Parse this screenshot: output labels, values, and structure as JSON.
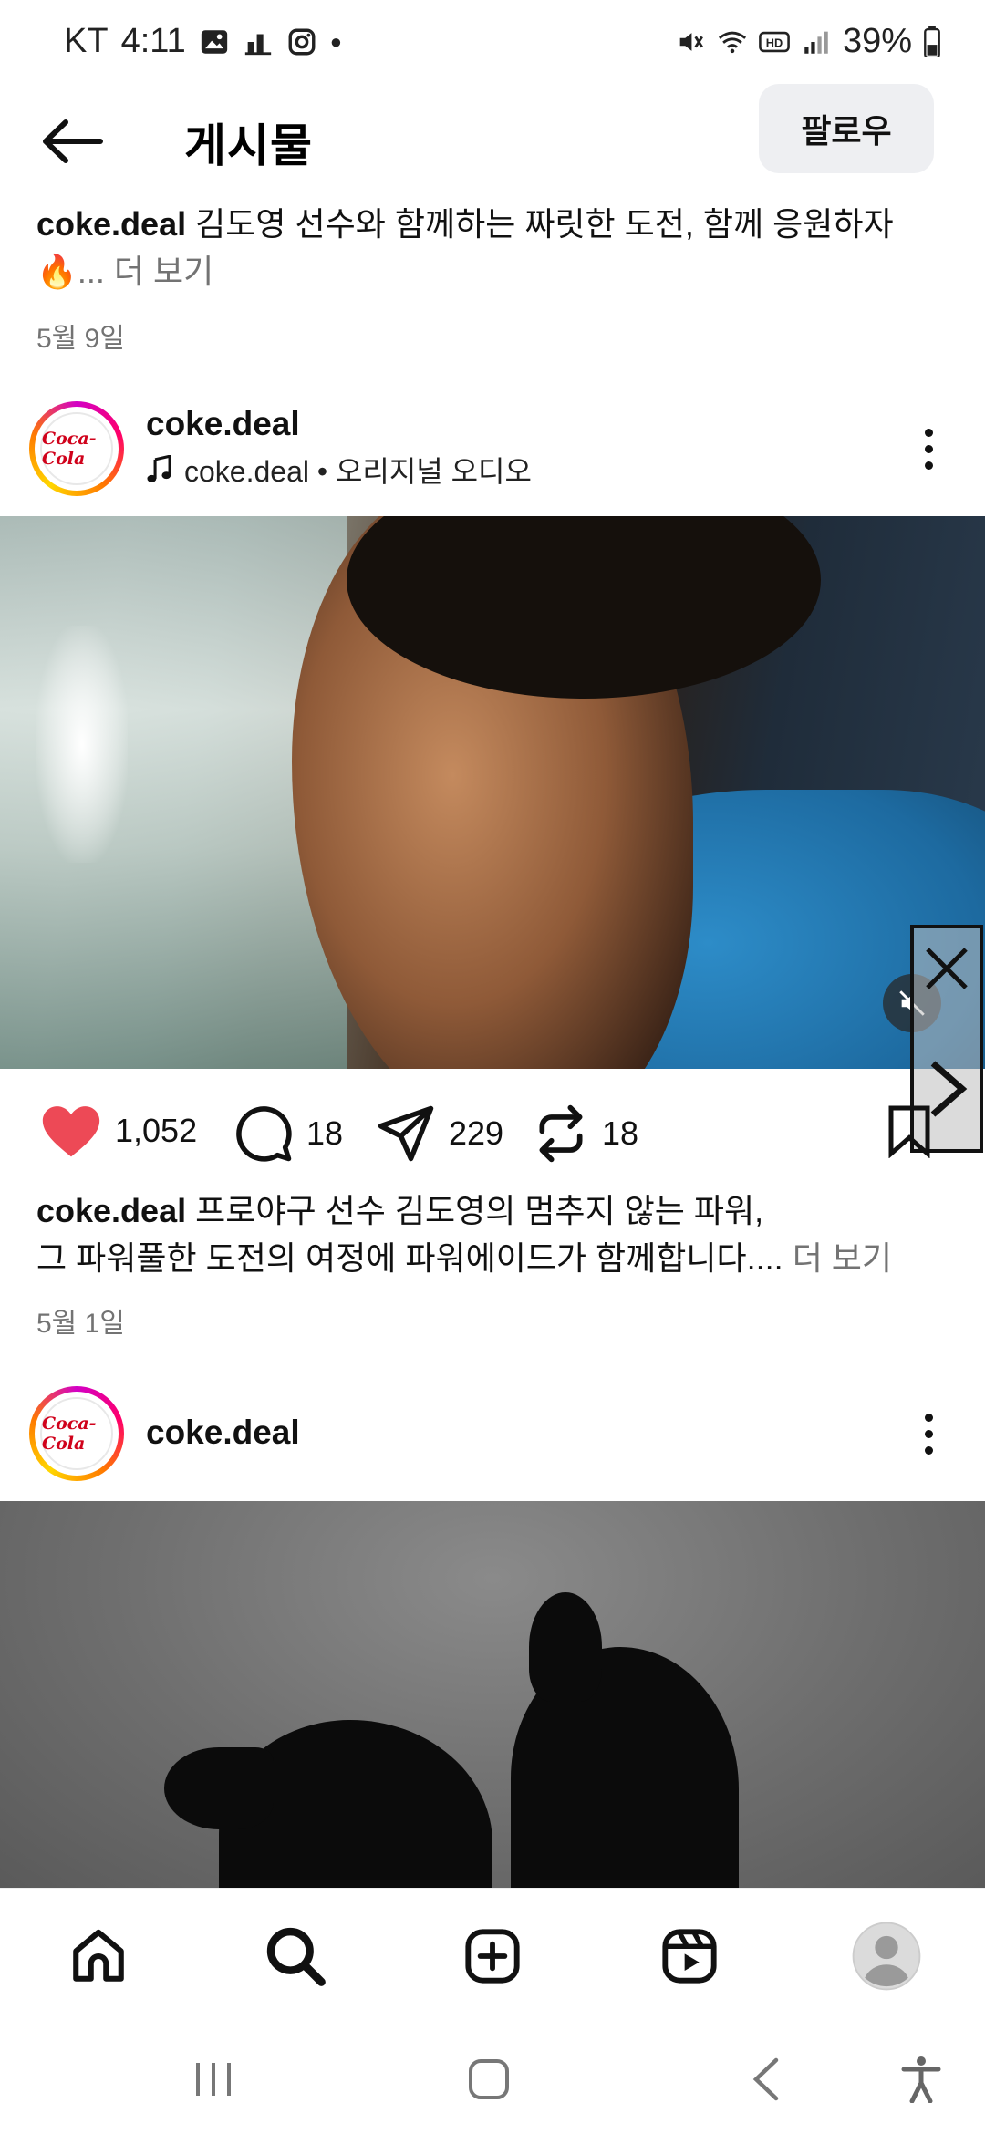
{
  "status_bar": {
    "carrier": "KT",
    "time": "4:11",
    "battery": "39%",
    "left_icons": [
      "gallery-icon",
      "chart-icon",
      "instagram-icon",
      "dot-icon"
    ],
    "right_icons": [
      "mute-icon",
      "wifi-icon",
      "hd-icon",
      "signal-icon",
      "battery-icon"
    ]
  },
  "header": {
    "title": "게시물",
    "follow_label": "팔로우"
  },
  "top_caption": {
    "username": "coke.deal",
    "text": "김도영 선수와 함께하는 짜릿한 도전, 함께 응원하자",
    "emoji": "🔥",
    "ellipsis": "...",
    "more": "더 보기",
    "date": "5월 9일"
  },
  "posts": [
    {
      "username": "coke.deal",
      "audio": "coke.deal • 오리지널 오디오",
      "avatar_text": "Coca-Cola",
      "likes": "1,052",
      "comments": "18",
      "shares": "229",
      "reposts": "18",
      "caption_username": "coke.deal",
      "caption_line1": "프로야구 선수 김도영의 멈추지 않는 파워,",
      "caption_line2": "그 파워풀한 도전의 여정에 파워에이드가 함께합니다....",
      "more": "더 보기",
      "date": "5월 1일"
    },
    {
      "username": "coke.deal",
      "avatar_text": "Coca-Cola"
    }
  ],
  "bottom_nav": [
    "home-icon",
    "search-icon",
    "create-icon",
    "reels-icon",
    "profile-icon"
  ],
  "system_nav": [
    "recents-icon",
    "home-icon",
    "back-icon",
    "accessibility-icon"
  ],
  "colors": {
    "like": "#ed4956",
    "secondary_text": "#737373",
    "follow_bg": "#eeeff2"
  }
}
